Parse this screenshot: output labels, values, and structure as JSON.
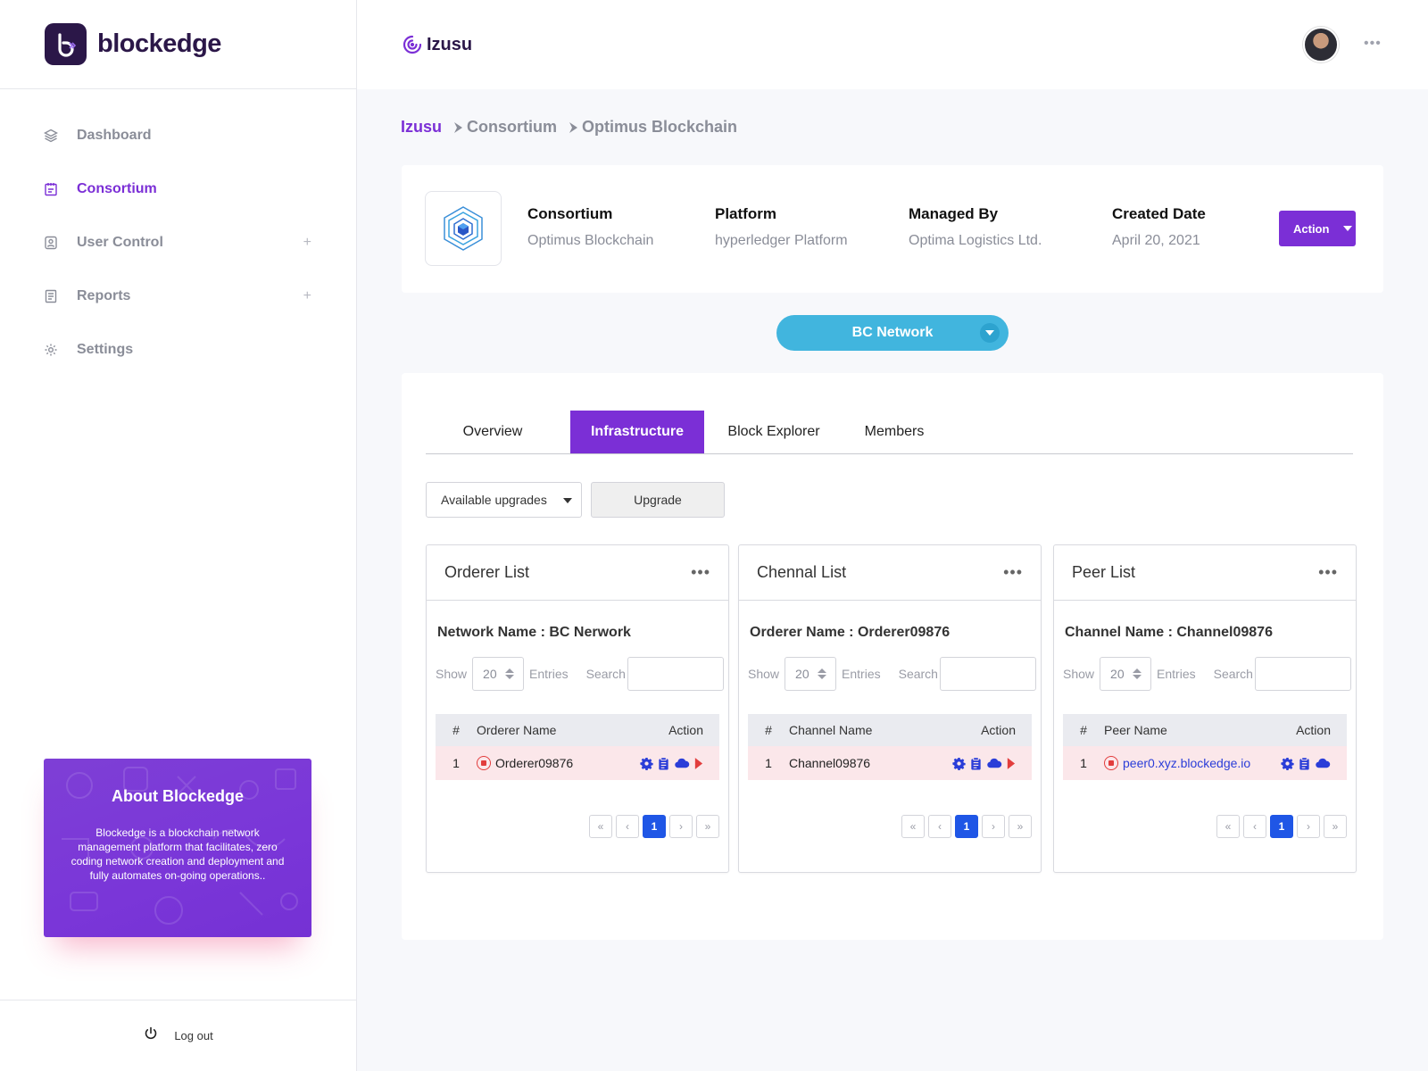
{
  "sidebar": {
    "logo_text": "blockedge",
    "items": [
      {
        "label": "Dashboard",
        "icon": "layers-icon"
      },
      {
        "label": "Consortium",
        "icon": "notepad-icon",
        "active": true
      },
      {
        "label": "User Control",
        "icon": "user-badge-icon",
        "expandable": "+"
      },
      {
        "label": "Reports",
        "icon": "report-icon",
        "expandable": "+"
      },
      {
        "label": "Settings",
        "icon": "gear-icon"
      }
    ],
    "about": {
      "title": "About Blockedge",
      "text": "Blockedge is a blockchain network management platform that facilitates, zero coding network creation and deployment and fully automates on-going operations.."
    },
    "logout_label": "Log out"
  },
  "header": {
    "brand": "Izusu",
    "more": "•••"
  },
  "breadcrumb": {
    "root": "Izusu",
    "items": [
      "Consortium",
      "Optimus Blockchain"
    ]
  },
  "info": {
    "consortium": {
      "title": "Consortium",
      "value": "Optimus Blockchain"
    },
    "platform": {
      "title": "Platform",
      "value": "hyperledger Platform"
    },
    "managed_by": {
      "title": "Managed By",
      "value": "Optima Logistics Ltd."
    },
    "created_date": {
      "title": "Created Date",
      "value": "April 20, 2021"
    },
    "action_label": "Action"
  },
  "network_select": "BC Network",
  "tabs": [
    "Overview",
    "Infrastructure",
    "Block Explorer",
    "Members"
  ],
  "active_tab": "Infrastructure",
  "upgrades": {
    "select_value": "Available upgrades",
    "button_label": "Upgrade"
  },
  "common": {
    "show": "Show",
    "entries_value": "20",
    "entries": "Entries",
    "search": "Search",
    "hash": "#",
    "action": "Action",
    "dots": "•••",
    "pager": [
      "«",
      "‹",
      "1",
      "›",
      "»"
    ]
  },
  "cards": {
    "orderer": {
      "title": "Orderer List",
      "subtitle": "Network Name : BC Nerwork",
      "col_name": "Orderer Name",
      "row": {
        "num": "1",
        "name": "Orderer09876"
      }
    },
    "channel": {
      "title": "Chennal List",
      "subtitle": "Orderer Name : Orderer09876",
      "col_name": "Channel Name",
      "row": {
        "num": "1",
        "name": "Channel09876"
      }
    },
    "peer": {
      "title": "Peer List",
      "subtitle": "Channel Name : Channel09876",
      "col_name": "Peer Name",
      "row": {
        "num": "1",
        "name": "peer0.xyz.blockedge.io"
      }
    }
  },
  "colors": {
    "accent": "#7b2fd6",
    "network_pill": "#41b5de",
    "row_highlight": "#fbe7ea",
    "pager_active": "#1f56e6",
    "stop_red": "#e23d3d",
    "icon_blue": "#2a3dd8"
  }
}
